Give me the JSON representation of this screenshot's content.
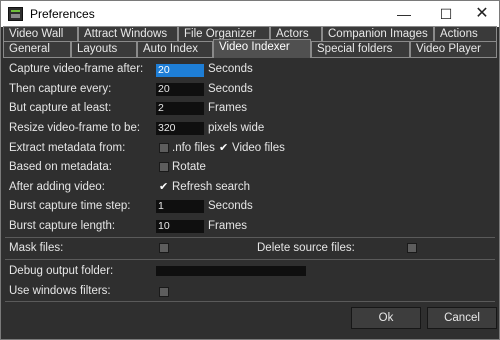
{
  "window": {
    "title": "Preferences"
  },
  "window_buttons": {
    "minimize": "—",
    "maximize": "☐",
    "close": "✕"
  },
  "tabs_row1": [
    "Video Wall",
    "Attract Windows",
    "File Organizer",
    "Actors",
    "Companion Images",
    "Actions"
  ],
  "tabs_row2": [
    "General",
    "Layouts",
    "Auto Index",
    "Video Indexer",
    "Special folders",
    "Video Player"
  ],
  "active_tab": "Video Indexer",
  "settings": {
    "capture_after": {
      "label": "Capture video-frame after:",
      "value": "20",
      "unit": "Seconds"
    },
    "capture_every": {
      "label": "Then capture every:",
      "value": "20",
      "unit": "Seconds"
    },
    "capture_least": {
      "label": "But capture at least:",
      "value": "2",
      "unit": "Frames"
    },
    "resize": {
      "label": "Resize video-frame to be:",
      "value": "320",
      "unit": "pixels wide"
    },
    "extract_metadata": {
      "label": "Extract metadata from:",
      "nfo_label": ".nfo files",
      "nfo_checked": false,
      "video_label": "Video files",
      "video_checked": true
    },
    "based_on_metadata": {
      "label": "Based on metadata:",
      "option_label": "Rotate",
      "checked": false
    },
    "after_adding": {
      "label": "After adding video:",
      "option_label": "Refresh search",
      "checked": true
    },
    "burst_step": {
      "label": "Burst capture time step:",
      "value": "1",
      "unit": "Seconds"
    },
    "burst_length": {
      "label": "Burst capture length:",
      "value": "10",
      "unit": "Frames"
    },
    "mask_files": {
      "label": "Mask files:",
      "checked": false
    },
    "delete_source": {
      "label": "Delete source files:",
      "checked": false
    },
    "debug_folder": {
      "label": "Debug output folder:",
      "value": ""
    },
    "windows_filters": {
      "label": "Use windows filters:",
      "checked": false
    }
  },
  "check_glyph": "✔",
  "buttons": {
    "ok": "Ok",
    "cancel": "Cancel"
  }
}
